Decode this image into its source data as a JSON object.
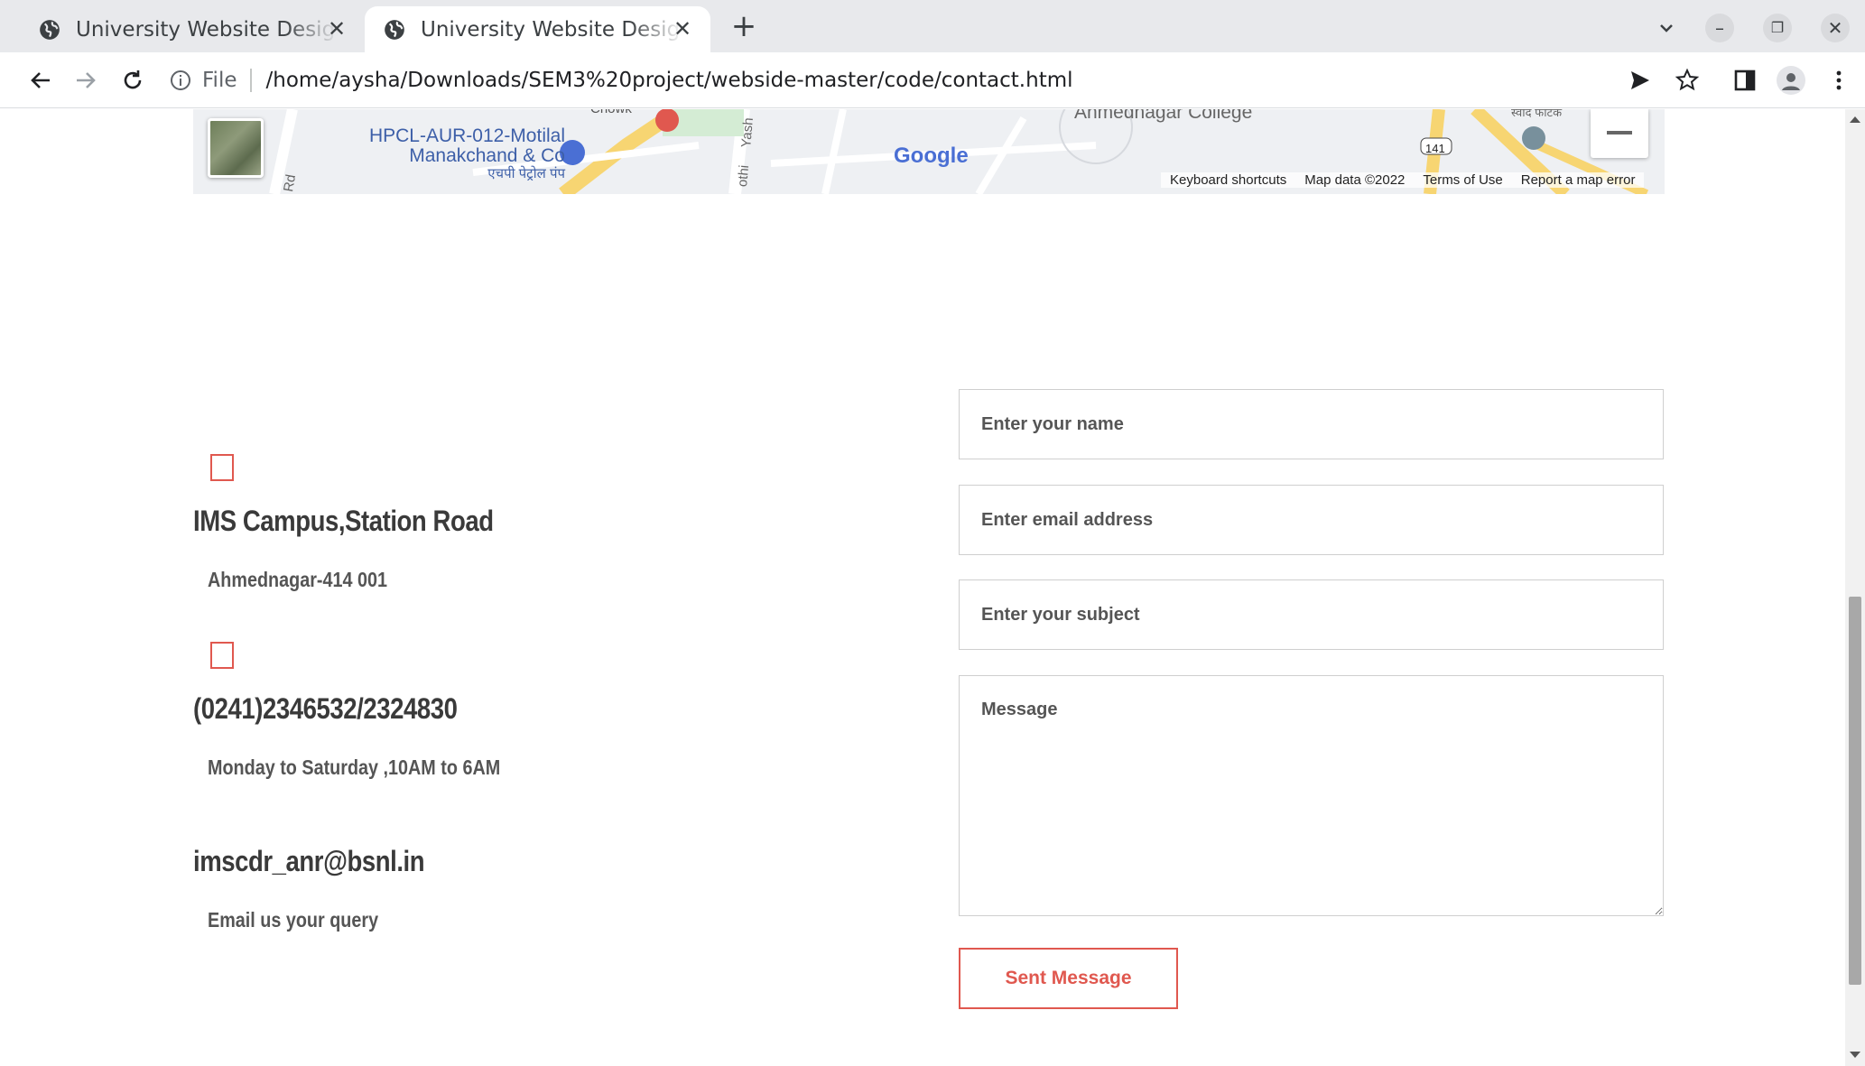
{
  "browser": {
    "tabs": [
      {
        "title": "University Website Design"
      },
      {
        "title": "University Website Design"
      }
    ],
    "address": {
      "scheme": "File",
      "url": "/home/aysha/Downloads/SEM3%20project/webside-master/code/contact.html"
    }
  },
  "map": {
    "labels": {
      "chowk": "Chowk",
      "hpcl_line1": "HPCL-AUR-012-Motilal",
      "hpcl_line2": "Manakchand & Co",
      "hpcl_line3": "एचपी पेट्रोल पंप",
      "road_rd": "Rd",
      "road_yash": "Yash",
      "road_othi": "othi",
      "college": "Ahmednagar College",
      "marathi": "स्वाद फाटक",
      "route": "141",
      "google": "Google"
    },
    "attribution": {
      "keyboard": "Keyboard shortcuts",
      "map_data": "Map data ©2022",
      "terms": "Terms of Use",
      "report": "Report a map error"
    }
  },
  "contact_info": {
    "address_title": "IMS Campus,Station Road",
    "address_sub": "Ahmednagar-414 001",
    "phone_title": "(0241)2346532/2324830",
    "phone_sub": "Monday to Saturday ,10AM to 6AM",
    "email_title": "imscdr_anr@bsnl.in",
    "email_sub": "Email us your query"
  },
  "form": {
    "name_placeholder": "Enter your name",
    "email_placeholder": "Enter email address",
    "subject_placeholder": "Enter your subject",
    "message_placeholder": "Message",
    "submit_label": "Sent Message"
  },
  "colors": {
    "accent": "#e0584f",
    "text_dark": "#3a3a3a"
  }
}
